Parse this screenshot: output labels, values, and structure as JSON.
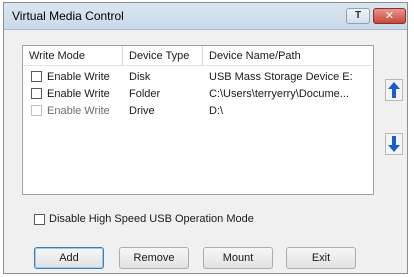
{
  "window": {
    "title": "Virtual Media Control",
    "pin_label": "T",
    "close_label": "✕"
  },
  "list": {
    "columns": [
      "Write Mode",
      "Device Type",
      "Device Name/Path"
    ],
    "rows": [
      {
        "write_mode": "Enable Write",
        "device_type": "Disk",
        "device_name": "USB Mass Storage Device E:",
        "enabled": true
      },
      {
        "write_mode": "Enable Write",
        "device_type": "Folder",
        "device_name": "C:\\Users\\terryerry\\Docume...",
        "enabled": true
      },
      {
        "write_mode": "Enable Write",
        "device_type": "Drive",
        "device_name": "D:\\",
        "enabled": false
      }
    ]
  },
  "option": {
    "label": "Disable High Speed USB Operation Mode"
  },
  "buttons": {
    "add": "Add",
    "remove": "Remove",
    "mount": "Mount",
    "exit": "Exit"
  },
  "icons": {
    "move_up": "arrow-up-icon",
    "move_down": "arrow-down-icon"
  },
  "colors": {
    "arrow_blue": "#1a5fc8",
    "close_red": "#c7463a"
  }
}
